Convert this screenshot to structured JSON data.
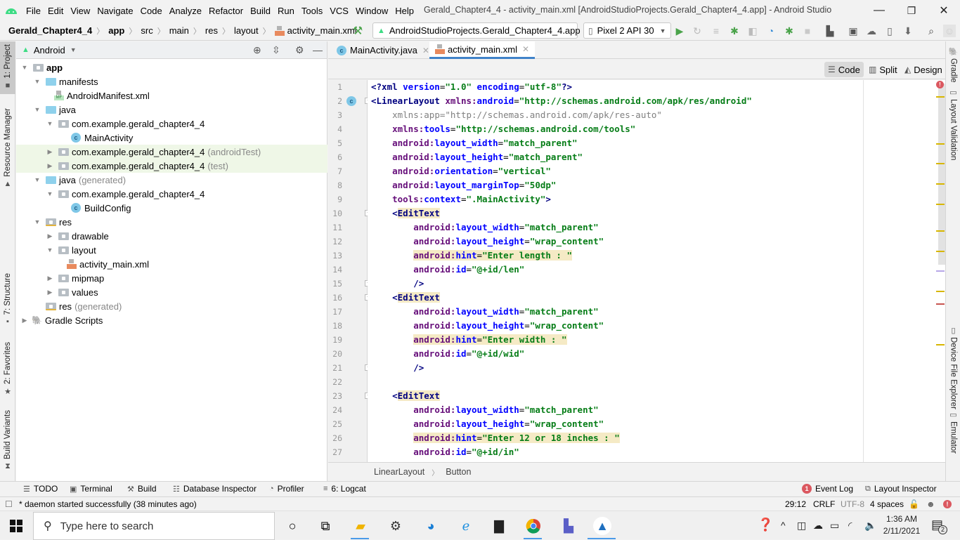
{
  "window": {
    "title": "Gerald_Chapter4_4 - activity_main.xml [AndroidStudioProjects.Gerald_Chapter4_4.app] - Android Studio",
    "menu": [
      "File",
      "Edit",
      "View",
      "Navigate",
      "Code",
      "Analyze",
      "Refactor",
      "Build",
      "Run",
      "Tools",
      "VCS",
      "Window",
      "Help"
    ],
    "controls": {
      "minimize": "—",
      "maximize": "❐",
      "close": "✕"
    }
  },
  "navbar": {
    "breadcrumb": [
      "Gerald_Chapter4_4",
      "app",
      "src",
      "main",
      "res",
      "layout",
      "activity_main.xml"
    ],
    "run_config": "AndroidStudioProjects.Gerald_Chapter4_4.app",
    "device": "Pixel 2 API 30"
  },
  "left_strip": [
    "1: Project",
    "Resource Manager",
    "7: Structure",
    "2: Favorites",
    "Build Variants"
  ],
  "right_strip": [
    "Gradle",
    "Layout Validation",
    "Device File Explorer",
    "Emulator"
  ],
  "project": {
    "view_mode": "Android",
    "tree": [
      {
        "label": "app",
        "depth": 0,
        "expanded": true,
        "icon": "module",
        "bold": true
      },
      {
        "label": "manifests",
        "depth": 1,
        "expanded": true,
        "icon": "folder-blue"
      },
      {
        "label": "AndroidManifest.xml",
        "depth": 2,
        "icon": "manifest"
      },
      {
        "label": "java",
        "depth": 1,
        "expanded": true,
        "icon": "folder-blue"
      },
      {
        "label": "com.example.gerald_chapter4_4",
        "depth": 2,
        "expanded": true,
        "icon": "package"
      },
      {
        "label": "MainActivity",
        "depth": 3,
        "icon": "class"
      },
      {
        "label": "com.example.gerald_chapter4_4",
        "suffix": "(androidTest)",
        "depth": 2,
        "expanded": false,
        "icon": "package",
        "highlight": true
      },
      {
        "label": "com.example.gerald_chapter4_4",
        "suffix": "(test)",
        "depth": 2,
        "expanded": false,
        "icon": "package",
        "highlight": true
      },
      {
        "label": "java",
        "suffix": "(generated)",
        "depth": 1,
        "expanded": true,
        "icon": "folder-generated"
      },
      {
        "label": "com.example.gerald_chapter4_4",
        "depth": 2,
        "expanded": true,
        "icon": "package"
      },
      {
        "label": "BuildConfig",
        "depth": 3,
        "icon": "class"
      },
      {
        "label": "res",
        "depth": 1,
        "expanded": true,
        "icon": "folder-res"
      },
      {
        "label": "drawable",
        "depth": 2,
        "expanded": false,
        "icon": "package"
      },
      {
        "label": "layout",
        "depth": 2,
        "expanded": true,
        "icon": "package"
      },
      {
        "label": "activity_main.xml",
        "depth": 3,
        "icon": "xml"
      },
      {
        "label": "mipmap",
        "depth": 2,
        "expanded": false,
        "icon": "package"
      },
      {
        "label": "values",
        "depth": 2,
        "expanded": false,
        "icon": "package"
      },
      {
        "label": "res",
        "suffix": "(generated)",
        "depth": 1,
        "icon": "folder-res"
      },
      {
        "label": "Gradle Scripts",
        "depth": 0,
        "expanded": false,
        "icon": "gradle"
      }
    ]
  },
  "editor": {
    "tabs": [
      {
        "label": "MainActivity.java",
        "active": false
      },
      {
        "label": "activity_main.xml",
        "active": true
      }
    ],
    "view_modes": [
      "Code",
      "Split",
      "Design"
    ],
    "selected_view": "Code",
    "lines": [
      {
        "n": 1,
        "text": "<?xml version=\"1.0\" encoding=\"utf-8\"?>"
      },
      {
        "n": 2,
        "text": "<LinearLayout xmlns:android=\"http://schemas.android.com/apk/res/android\""
      },
      {
        "n": 3,
        "text": "    xmlns:app=\"http://schemas.android.com/apk/res-auto\""
      },
      {
        "n": 4,
        "text": "    xmlns:tools=\"http://schemas.android.com/tools\""
      },
      {
        "n": 5,
        "text": "    android:layout_width=\"match_parent\""
      },
      {
        "n": 6,
        "text": "    android:layout_height=\"match_parent\""
      },
      {
        "n": 7,
        "text": "    android:orientation=\"vertical\""
      },
      {
        "n": 8,
        "text": "    android:layout_marginTop=\"50dp\""
      },
      {
        "n": 9,
        "text": "    tools:context=\".MainActivity\">"
      },
      {
        "n": 10,
        "text": "    <EditText"
      },
      {
        "n": 11,
        "text": "        android:layout_width=\"match_parent\""
      },
      {
        "n": 12,
        "text": "        android:layout_height=\"wrap_content\""
      },
      {
        "n": 13,
        "text": "        android:hint=\"Enter length : \""
      },
      {
        "n": 14,
        "text": "        android:id=\"@+id/len\""
      },
      {
        "n": 15,
        "text": "        />"
      },
      {
        "n": 16,
        "text": "    <EditText"
      },
      {
        "n": 17,
        "text": "        android:layout_width=\"match_parent\""
      },
      {
        "n": 18,
        "text": "        android:layout_height=\"wrap_content\""
      },
      {
        "n": 19,
        "text": "        android:hint=\"Enter width : \""
      },
      {
        "n": 20,
        "text": "        android:id=\"@+id/wid\""
      },
      {
        "n": 21,
        "text": "        />"
      },
      {
        "n": 22,
        "text": ""
      },
      {
        "n": 23,
        "text": "    <EditText"
      },
      {
        "n": 24,
        "text": "        android:layout_width=\"match_parent\""
      },
      {
        "n": 25,
        "text": "        android:layout_height=\"wrap_content\""
      },
      {
        "n": 26,
        "text": "        android:hint=\"Enter 12 or 18 inches : \""
      },
      {
        "n": 27,
        "text": "        android:id=\"@+id/in\""
      }
    ],
    "breadcrumb": [
      "LinearLayout",
      "Button"
    ]
  },
  "bottom_tools": {
    "left": [
      "TODO",
      "Terminal",
      "Build",
      "Database Inspector",
      "Profiler",
      "6: Logcat"
    ],
    "right": [
      {
        "label": "Event Log",
        "badge": "1"
      },
      {
        "label": "Layout Inspector"
      }
    ]
  },
  "status": {
    "message": "* daemon started successfully (38 minutes ago)",
    "position": "29:12",
    "line_ending": "CRLF",
    "encoding": "UTF-8",
    "indent": "4 spaces"
  },
  "taskbar": {
    "search_placeholder": "Type here to search",
    "time": "1:36 AM",
    "date": "2/11/2021",
    "notifications": "2"
  },
  "colors": {
    "accent_tab": "#4083c9",
    "android_green": "#3ddc84",
    "error_red": "#db5860",
    "highlight": "#f5eac5"
  }
}
